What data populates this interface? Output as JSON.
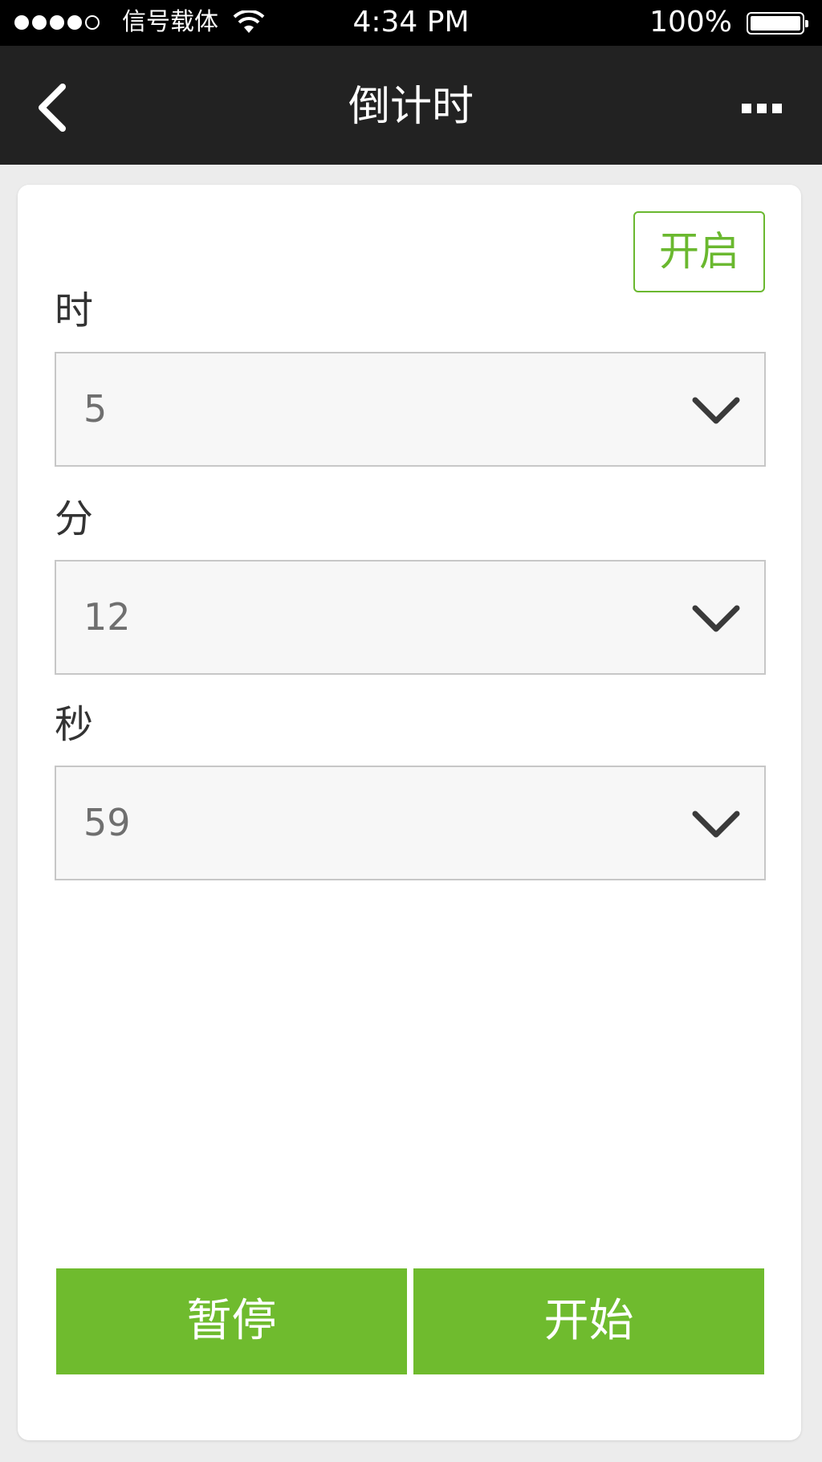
{
  "status_bar": {
    "carrier": "信号载体",
    "time": "4:34 PM",
    "battery": "100%"
  },
  "nav": {
    "title": "倒计时",
    "back_icon": "chevron-left-icon",
    "menu_icon": "more-dots-icon"
  },
  "toggle": {
    "label": "开启",
    "color": "#6ab82f"
  },
  "fields": {
    "hours": {
      "label": "时",
      "value": "5"
    },
    "minutes": {
      "label": "分",
      "value": "12"
    },
    "seconds": {
      "label": "秒",
      "value": "59"
    }
  },
  "buttons": {
    "pause": "暂停",
    "start": "开始",
    "color": "#6fbb2e"
  }
}
